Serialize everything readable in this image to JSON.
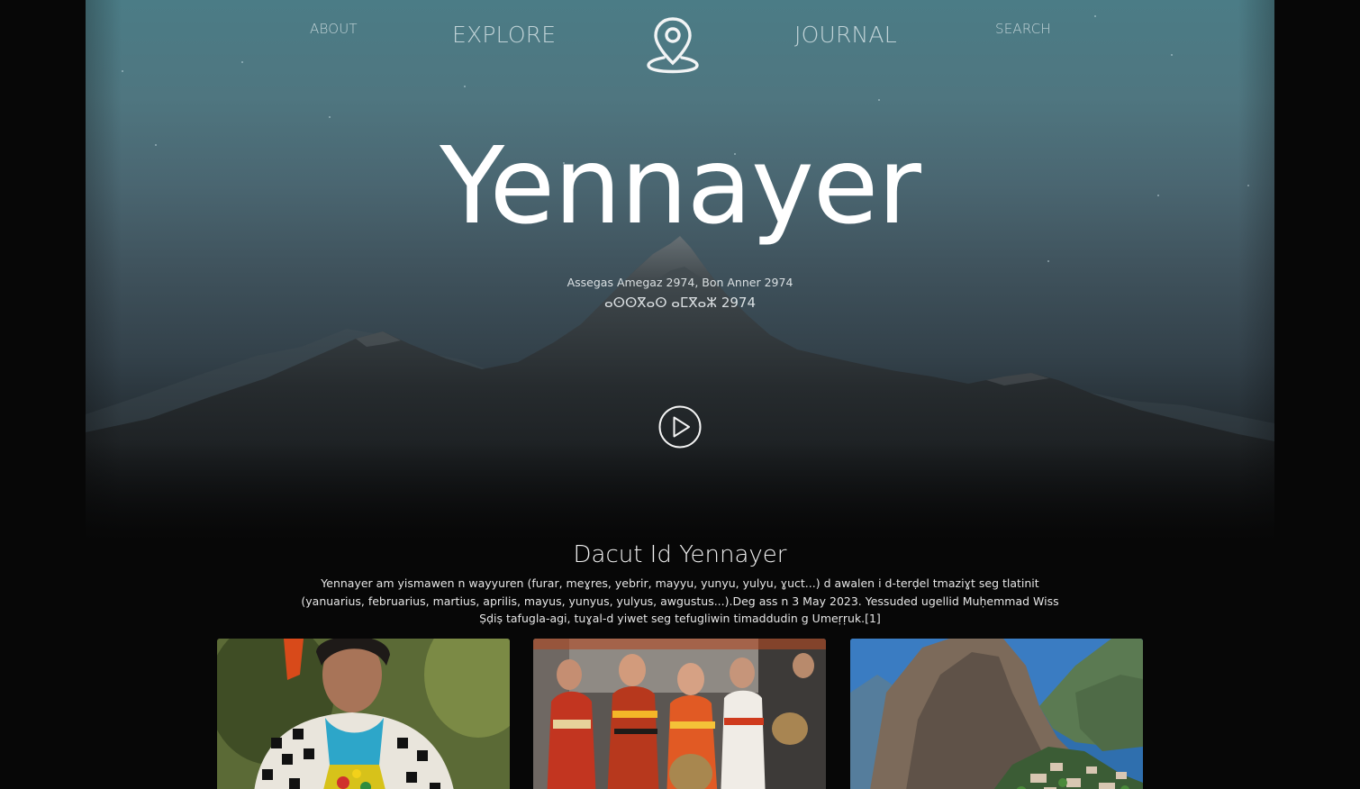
{
  "nav": {
    "about": "ABOUT",
    "explore": "EXPLORE",
    "journal": "JOURNAL",
    "search": "SEARCH",
    "logo_icon": "map-pin-icon"
  },
  "hero": {
    "title": "Yennayer",
    "subtitle": "Assegas Amegaz 2974, Bon Anner 2974",
    "tifinagh": "ⴰⵙⵙⴳⴰⵙ ⴰⵎⴳⴰⵣ 2974",
    "play_icon": "play-icon"
  },
  "section": {
    "title": "Dacut Id Yennayer",
    "body": "Yennayer am yismawen n wayyuren (furar, meɣres, yebrir, mayyu, yunyu, yulyu, ɣuct...) d awalen i d-terḍel tmaziɣt seg tlatinit (yanuarius, februarius, martius, aprilis, mayus, yunyus, yulyus, awgustus...).Deg ass n 3 May 2023. Yessuded ugellid Muḥemmad Wiss Ṣḍiṣ tafugla-agi, tuɣal-d yiwet seg tefugliwin timaddudin g Umeṛṛuk.[1]"
  },
  "cards": [
    {
      "subject": "woman-in-traditional-dress"
    },
    {
      "subject": "festival-parade-women"
    },
    {
      "subject": "mountain-village"
    }
  ],
  "colors": {
    "background": "#070707",
    "sky_top": "#4b7c86",
    "text": "#ffffff"
  }
}
